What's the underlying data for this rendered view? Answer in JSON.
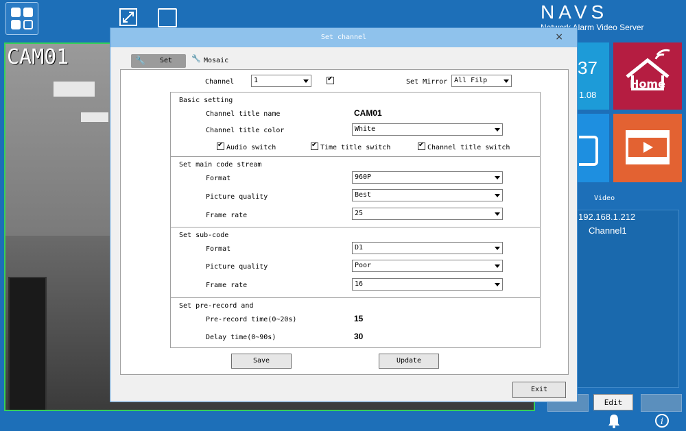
{
  "topbar": {
    "brand": "NAVS",
    "brand_subtitle": "Network Alarm Video Server"
  },
  "camera": {
    "overlay_title": "CAM01"
  },
  "tiles": {
    "clock_fragment": "37",
    "date_fragment": "1.08",
    "home_label": "Home"
  },
  "side": {
    "video_label": "Video",
    "device_ip": "192.168.1.212",
    "channel": "Channel1",
    "edit_label": "Edit"
  },
  "dialog": {
    "title": "Set channel",
    "close": "×",
    "tabs": [
      {
        "label": "Set"
      },
      {
        "label": "Mosaic"
      }
    ],
    "channel_label": "Channel",
    "channel_value": "1",
    "mirror_label": "Set Mirror",
    "mirror_value": "All Filp",
    "basic": {
      "heading": "Basic setting",
      "title_name_label": "Channel title name",
      "title_name_value": "CAM01",
      "title_color_label": "Channel title color",
      "title_color_value": "White",
      "audio_switch": "Audio switch",
      "time_title_switch": "Time title switch",
      "channel_title_switch": "Channel title switch"
    },
    "main_stream": {
      "heading": "Set main code stream",
      "format_label": "Format",
      "format_value": "960P",
      "quality_label": "Picture quality",
      "quality_value": "Best",
      "frame_label": "Frame rate",
      "frame_value": "25"
    },
    "sub_stream": {
      "heading": "Set sub-code",
      "format_label": "Format",
      "format_value": "D1",
      "quality_label": "Picture quality",
      "quality_value": "Poor",
      "frame_label": "Frame rate",
      "frame_value": "16"
    },
    "prerecord": {
      "heading": "Set pre-record and",
      "pre_label": "Pre-record time(0~20s)",
      "pre_value": "15",
      "delay_label": "Delay time(0~90s)",
      "delay_value": "30"
    },
    "save_label": "Save",
    "update_label": "Update",
    "exit_label": "Exit"
  }
}
